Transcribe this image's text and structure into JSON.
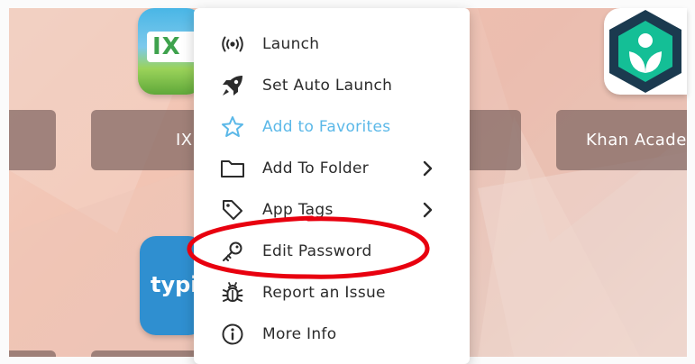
{
  "apps": {
    "ixl": {
      "icon_text": "IX",
      "label": "IX"
    },
    "khan": {
      "label": "Khan Acade"
    },
    "typing": {
      "icon_text": "typi"
    }
  },
  "context_menu": {
    "items": [
      {
        "id": "launch",
        "label": "Launch",
        "icon": "broadcast-icon",
        "has_submenu": false
      },
      {
        "id": "set-auto-launch",
        "label": "Set Auto Launch",
        "icon": "rocket-icon",
        "has_submenu": false
      },
      {
        "id": "add-to-favorites",
        "label": "Add to Favorites",
        "icon": "star-icon",
        "has_submenu": false,
        "accent": true
      },
      {
        "id": "add-to-folder",
        "label": "Add To Folder",
        "icon": "folder-icon",
        "has_submenu": true
      },
      {
        "id": "app-tags",
        "label": "App Tags",
        "icon": "tag-icon",
        "has_submenu": true
      },
      {
        "id": "edit-password",
        "label": "Edit Password",
        "icon": "key-icon",
        "has_submenu": false,
        "highlighted": true
      },
      {
        "id": "report-an-issue",
        "label": "Report an Issue",
        "icon": "bug-icon",
        "has_submenu": false
      },
      {
        "id": "more-info",
        "label": "More Info",
        "icon": "info-icon",
        "has_submenu": false
      }
    ]
  },
  "colors": {
    "accent": "#5bb8e8",
    "highlight_ring": "#e8000f",
    "tile_label_bg": "#806561",
    "khan_green": "#14bf96",
    "khan_dark": "#1b3a4f",
    "typing_blue": "#2f8fd0"
  }
}
